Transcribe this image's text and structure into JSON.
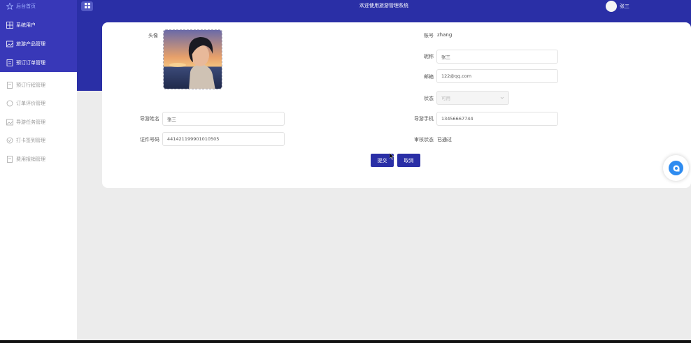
{
  "header": {
    "title": "欢迎使用旅游管理系统",
    "user_name": "张三"
  },
  "sidebar": {
    "items": [
      {
        "label": "后台首页",
        "icon": "star-icon"
      },
      {
        "label": "系统用户",
        "icon": "grid-icon"
      },
      {
        "label": "旅游产品管理",
        "icon": "image-icon"
      },
      {
        "label": "预订订单管理",
        "icon": "order-icon"
      },
      {
        "label": "预订行程管理",
        "icon": "doc-icon"
      },
      {
        "label": "订单评价管理",
        "icon": "chat-icon"
      },
      {
        "label": "导游任务管理",
        "icon": "image-icon"
      },
      {
        "label": "打卡签到管理",
        "icon": "check-icon"
      },
      {
        "label": "费用报销管理",
        "icon": "doc-icon"
      }
    ]
  },
  "form": {
    "avatar_label": "头像",
    "account_label": "账号",
    "account_value": "zhang",
    "nickname_label": "昵称",
    "nickname_value": "张三",
    "email_label": "邮箱",
    "email_value": "122@qq.com",
    "status_label": "状态",
    "status_value": "可用",
    "guide_name_label": "导游姓名",
    "guide_name_value": "张三",
    "guide_phone_label": "导游手机",
    "guide_phone_value": "13456667744",
    "id_label": "证件号码",
    "id_value": "441421199901010505",
    "audit_label": "审核状态",
    "audit_value": "已通过",
    "submit_label": "提交",
    "cancel_label": "取消"
  },
  "colors": {
    "primary": "#2a2fa6",
    "sidebar_top": "#3838b8"
  }
}
